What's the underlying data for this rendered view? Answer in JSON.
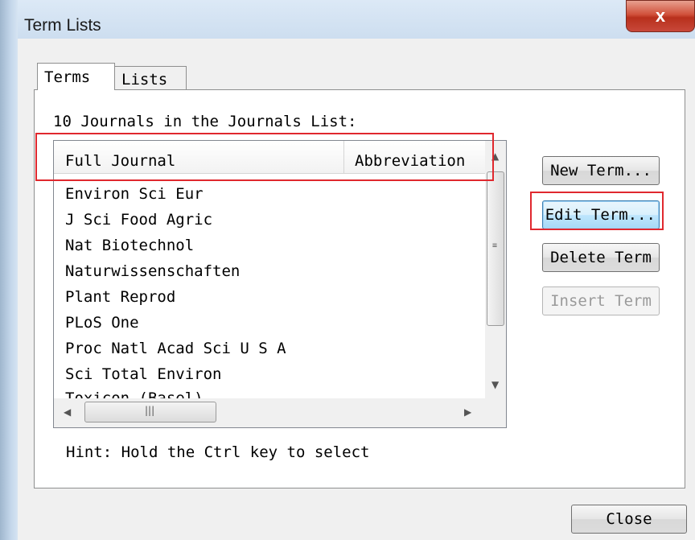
{
  "window": {
    "title": "Term Lists",
    "close_glyph": "x"
  },
  "tabs": [
    {
      "label": "Terms",
      "active": true
    },
    {
      "label": "Lists",
      "active": false
    }
  ],
  "list_caption": "10 Journals in the Journals List:",
  "columns": {
    "full": "Full Journal",
    "abbr": "Abbreviation"
  },
  "journals": [
    "Environ Sci Eur",
    "J Sci Food Agric",
    "Nat Biotechnol",
    "Naturwissenschaften",
    "Plant Reprod",
    "PLoS One",
    "Proc Natl Acad Sci U S A",
    "Sci Total Environ",
    "Toxicon (Basel)"
  ],
  "hint": "Hint: Hold the Ctrl key to select",
  "buttons": {
    "new_term": "New Term...",
    "edit_term": "Edit Term...",
    "delete_term": "Delete Term",
    "insert_term": "Insert Term",
    "close": "Close"
  },
  "colors": {
    "highlight_box": "#e0282e"
  }
}
